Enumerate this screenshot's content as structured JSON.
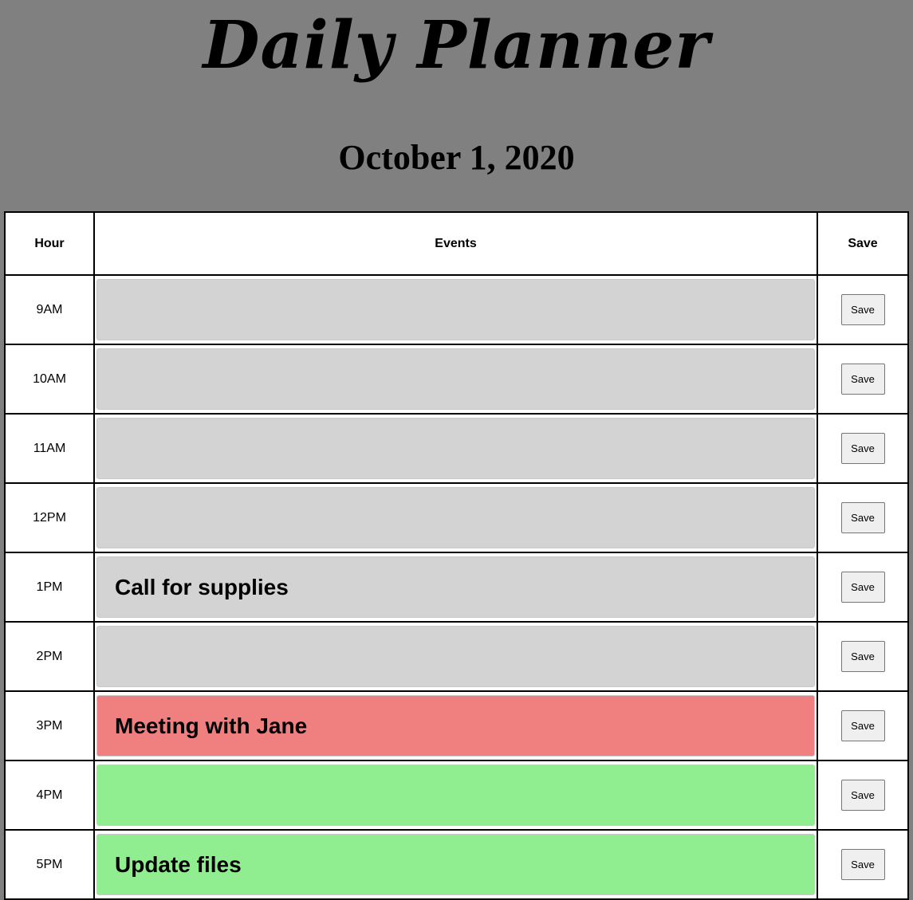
{
  "header": {
    "title": "Daily Planner",
    "date": "October 1, 2020"
  },
  "table": {
    "columns": {
      "hour": "Hour",
      "events": "Events",
      "save": "Save"
    },
    "rows": [
      {
        "hour": "9AM",
        "event": "",
        "state": "past",
        "save_label": "Save"
      },
      {
        "hour": "10AM",
        "event": "",
        "state": "past",
        "save_label": "Save"
      },
      {
        "hour": "11AM",
        "event": "",
        "state": "past",
        "save_label": "Save"
      },
      {
        "hour": "12PM",
        "event": "",
        "state": "past",
        "save_label": "Save"
      },
      {
        "hour": "1PM",
        "event": "Call for supplies",
        "state": "past",
        "save_label": "Save"
      },
      {
        "hour": "2PM",
        "event": "",
        "state": "past",
        "save_label": "Save"
      },
      {
        "hour": "3PM",
        "event": "Meeting with Jane",
        "state": "present",
        "save_label": "Save"
      },
      {
        "hour": "4PM",
        "event": "",
        "state": "future",
        "save_label": "Save"
      },
      {
        "hour": "5PM",
        "event": "Update files",
        "state": "future",
        "save_label": "Save"
      }
    ]
  },
  "colors": {
    "page_background": "#808080",
    "past": "#d3d3d3",
    "present": "#f08080",
    "future": "#90ee90"
  }
}
